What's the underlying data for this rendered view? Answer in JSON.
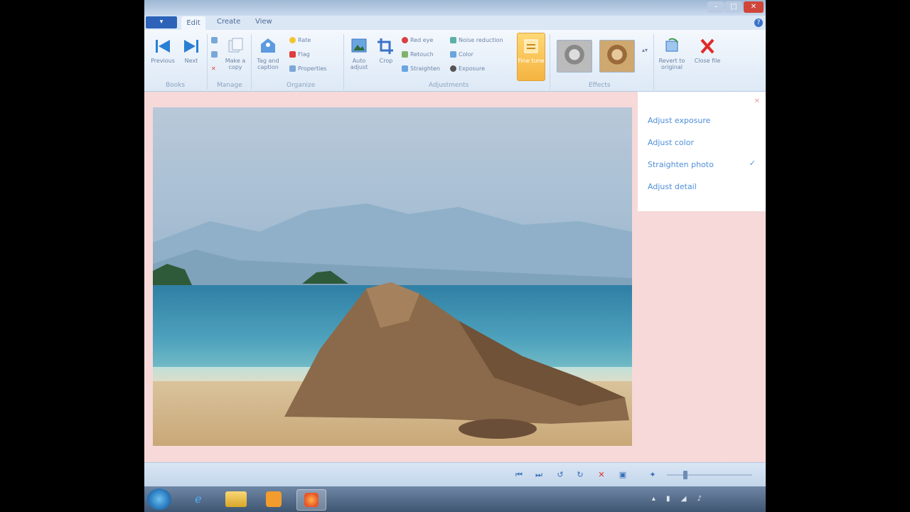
{
  "window": {
    "title": "",
    "controls": {
      "minimize": "–",
      "maximize": "□",
      "close": "✕"
    }
  },
  "ribbon": {
    "app_menu": "▾",
    "tabs": [
      {
        "label": "Edit"
      },
      {
        "label": "Create"
      },
      {
        "label": "View"
      }
    ],
    "help": "?",
    "groups": [
      {
        "label": "Books"
      },
      {
        "label": "Manage"
      },
      {
        "label": "Organize"
      },
      {
        "label": "Adjustments"
      },
      {
        "label": "Effects"
      }
    ],
    "buttons": {
      "previous": "Previous",
      "next": "Next",
      "make_copy": "Make a copy",
      "tag_caption": "Tag and caption",
      "rate": "Rate",
      "flag": "Flag",
      "properties": "Properties",
      "auto_adjust": "Auto adjust",
      "crop": "Crop",
      "red_eye": "Red eye",
      "retouch": "Retouch",
      "straighten": "Straighten",
      "noise_reduction": "Noise reduction",
      "color": "Color",
      "exposure": "Exposure",
      "fine_tune": "Fine tune",
      "revert": "Revert to original",
      "close_file": "Close file"
    }
  },
  "side_panel": {
    "options": [
      {
        "label": "Adjust exposure"
      },
      {
        "label": "Adjust color"
      },
      {
        "label": "Straighten photo",
        "checked": true
      },
      {
        "label": "Adjust detail"
      }
    ],
    "check": "✓",
    "close": "✕"
  },
  "status_bar": {
    "text": ""
  },
  "taskbar": {
    "time": "",
    "date": ""
  },
  "colors": {
    "accent": "#4f8fd8",
    "ribbon": "#dde9f6",
    "panel": "#f7d9d9"
  }
}
